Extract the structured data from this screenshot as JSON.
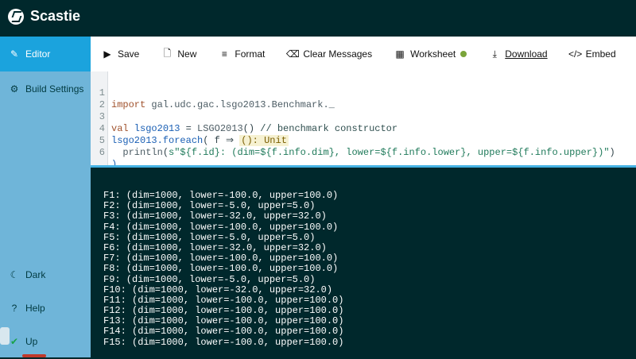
{
  "app": {
    "title": "Scastie"
  },
  "sidebar": {
    "items": [
      {
        "id": "editor",
        "label": "Editor",
        "icon": "edit-icon"
      },
      {
        "id": "build-settings",
        "label": "Build Settings",
        "icon": "gear-icon"
      }
    ],
    "bottom": [
      {
        "id": "dark",
        "label": "Dark",
        "icon": "moon-icon"
      },
      {
        "id": "help",
        "label": "Help",
        "icon": "help-icon"
      },
      {
        "id": "up",
        "label": "Up",
        "icon": "status-check-icon"
      }
    ]
  },
  "toolbar": {
    "buttons": [
      {
        "id": "save",
        "label": "Save",
        "icon": "play-icon"
      },
      {
        "id": "new",
        "label": "New",
        "icon": "file-icon"
      },
      {
        "id": "format",
        "label": "Format",
        "icon": "align-left-icon"
      },
      {
        "id": "clear",
        "label": "Clear Messages",
        "icon": "eraser-icon"
      },
      {
        "id": "worksheet",
        "label": "Worksheet",
        "icon": "calendar-icon",
        "status_color": "#7aa43a"
      },
      {
        "id": "download",
        "label": "Download",
        "icon": "download-icon"
      },
      {
        "id": "embed",
        "label": "Embed",
        "icon": "code-icon"
      }
    ]
  },
  "editor": {
    "line_numbers": [
      "1",
      "2",
      "3",
      "4",
      "5",
      "6"
    ],
    "lines": {
      "l1_import": "import",
      "l1_rest": " gal.udc.gac.lsgo2013.Benchmark._",
      "l3_val": "val",
      "l3_name": " lsgo2013",
      "l3_eq": " = ",
      "l3_ctor": "LSGO2013",
      "l3_paren": "()",
      "l3_comment": " // benchmark constructor",
      "l4_obj": "lsgo2013",
      "l4_method": ".foreach",
      "l4_args": "( f ⇒ ",
      "l4_hint": "(): Unit",
      "l5_indent": "  ",
      "l5_println": "println",
      "l5_paren": "(",
      "l5_str": "s\"${f.id}: (dim=${f.info.dim}, lower=${f.info.lower}, upper=${f.info.upper})\"",
      "l5_close": ")",
      "l6": ")"
    }
  },
  "console": {
    "lines": [
      "F1: (dim=1000, lower=-100.0, upper=100.0)",
      "F2: (dim=1000, lower=-5.0, upper=5.0)",
      "F3: (dim=1000, lower=-32.0, upper=32.0)",
      "F4: (dim=1000, lower=-100.0, upper=100.0)",
      "F5: (dim=1000, lower=-5.0, upper=5.0)",
      "F6: (dim=1000, lower=-32.0, upper=32.0)",
      "F7: (dim=1000, lower=-100.0, upper=100.0)",
      "F8: (dim=1000, lower=-100.0, upper=100.0)",
      "F9: (dim=1000, lower=-5.0, upper=5.0)",
      "F10: (dim=1000, lower=-32.0, upper=32.0)",
      "F11: (dim=1000, lower=-100.0, upper=100.0)",
      "F12: (dim=1000, lower=-100.0, upper=100.0)",
      "F13: (dim=1000, lower=-100.0, upper=100.0)",
      "F14: (dim=1000, lower=-100.0, upper=100.0)",
      "F15: (dim=1000, lower=-100.0, upper=100.0)"
    ]
  },
  "colors": {
    "topbar": "#00282c",
    "sidebar": "#6fb5d9",
    "sidebar_active": "#1ba3dd",
    "divider": "#45b2e3",
    "console_bg": "#00282c",
    "status_ok": "#1aa24b"
  }
}
